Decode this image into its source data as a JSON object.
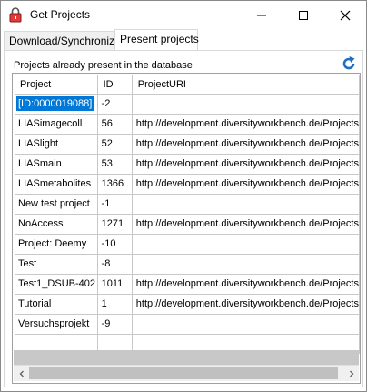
{
  "window": {
    "title": "Get Projects",
    "icons": {
      "app": "lock-icon",
      "minimize": "minimize-icon",
      "maximize": "maximize-icon",
      "close": "close-icon"
    }
  },
  "tabs": [
    {
      "label": "Download/Synchronize",
      "selected": false
    },
    {
      "label": "Present projects",
      "selected": true
    }
  ],
  "panel": {
    "caption": "Projects already present in the database",
    "refresh_icon": "refresh-icon"
  },
  "grid": {
    "columns": [
      "Project",
      "ID",
      "ProjectURI"
    ],
    "rows": [
      {
        "project": "[ID:0000019088]",
        "id": "-2",
        "uri": "",
        "selected": true
      },
      {
        "project": "LIASimagecoll",
        "id": "56",
        "uri": "http://development.diversityworkbench.de/Projects"
      },
      {
        "project": "LIASlight",
        "id": "52",
        "uri": "http://development.diversityworkbench.de/Projects"
      },
      {
        "project": "LIASmain",
        "id": "53",
        "uri": "http://development.diversityworkbench.de/Projects"
      },
      {
        "project": "LIASmetabolites",
        "id": "1366",
        "uri": "http://development.diversityworkbench.de/Projects"
      },
      {
        "project": "New test project",
        "id": "-1",
        "uri": ""
      },
      {
        "project": "NoAccess",
        "id": "1271",
        "uri": "http://development.diversityworkbench.de/Projects"
      },
      {
        "project": "Project: Deemy",
        "id": "-10",
        "uri": ""
      },
      {
        "project": "Test",
        "id": "-8",
        "uri": ""
      },
      {
        "project": "Test1_DSUB-402",
        "id": "1011",
        "uri": "http://development.diversityworkbench.de/Projects"
      },
      {
        "project": "Tutorial",
        "id": "1",
        "uri": "http://development.diversityworkbench.de/Projects"
      },
      {
        "project": "Versuchsprojekt",
        "id": "-9",
        "uri": ""
      }
    ]
  },
  "colors": {
    "selection": "#0078d7",
    "refresh": "#1e6fc4"
  }
}
